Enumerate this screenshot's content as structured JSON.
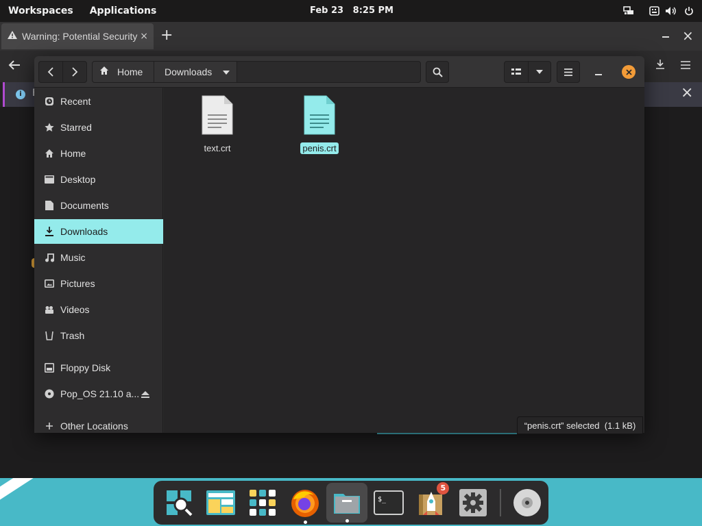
{
  "top_panel": {
    "workspaces": "Workspaces",
    "applications": "Applications",
    "clock": "Feb 23   8:25 PM",
    "tray_icons": [
      "network-icon",
      "keyboard-icon",
      "volume-icon",
      "power-icon"
    ]
  },
  "browser": {
    "tab_title": "Warning: Potential Security",
    "tab_close": "×",
    "new_tab": "+",
    "notification_text": "F",
    "close_glyph": "×"
  },
  "file_chooser": {
    "path": {
      "home_label": "Home",
      "current_label": "Downloads"
    },
    "sidebar": {
      "items": [
        {
          "label": "Recent",
          "icon": "clock-icon"
        },
        {
          "label": "Starred",
          "icon": "star-icon"
        },
        {
          "label": "Home",
          "icon": "home-icon"
        },
        {
          "label": "Desktop",
          "icon": "desktop-folder-icon"
        },
        {
          "label": "Documents",
          "icon": "document-icon"
        },
        {
          "label": "Downloads",
          "icon": "download-icon",
          "selected": true
        },
        {
          "label": "Music",
          "icon": "music-icon"
        },
        {
          "label": "Pictures",
          "icon": "picture-icon"
        },
        {
          "label": "Videos",
          "icon": "video-icon"
        },
        {
          "label": "Trash",
          "icon": "trash-icon"
        },
        {
          "label": "Floppy Disk",
          "icon": "drive-icon"
        },
        {
          "label": "Pop_OS 21.10 a...",
          "icon": "disc-icon",
          "ejectable": true
        },
        {
          "label": "Other Locations",
          "icon": "plus-icon"
        }
      ]
    },
    "files": [
      {
        "name": "text.crt",
        "selected": false
      },
      {
        "name": "penis.crt",
        "selected": true
      }
    ],
    "status": "“penis.crt” selected  (1.1 kB)"
  },
  "dock": {
    "items": [
      "search-app-icon",
      "files-app-icon",
      "app-grid-icon",
      "firefox-icon",
      "file-manager-icon",
      "terminal-icon",
      "pop-shop-icon",
      "settings-icon",
      "disc-drive-icon"
    ],
    "badge": "5"
  },
  "colors": {
    "accent": "#94ebeb",
    "close_orange": "#f29b38",
    "desktop_teal": "#48b9c7",
    "badge_red": "#e0533f"
  }
}
